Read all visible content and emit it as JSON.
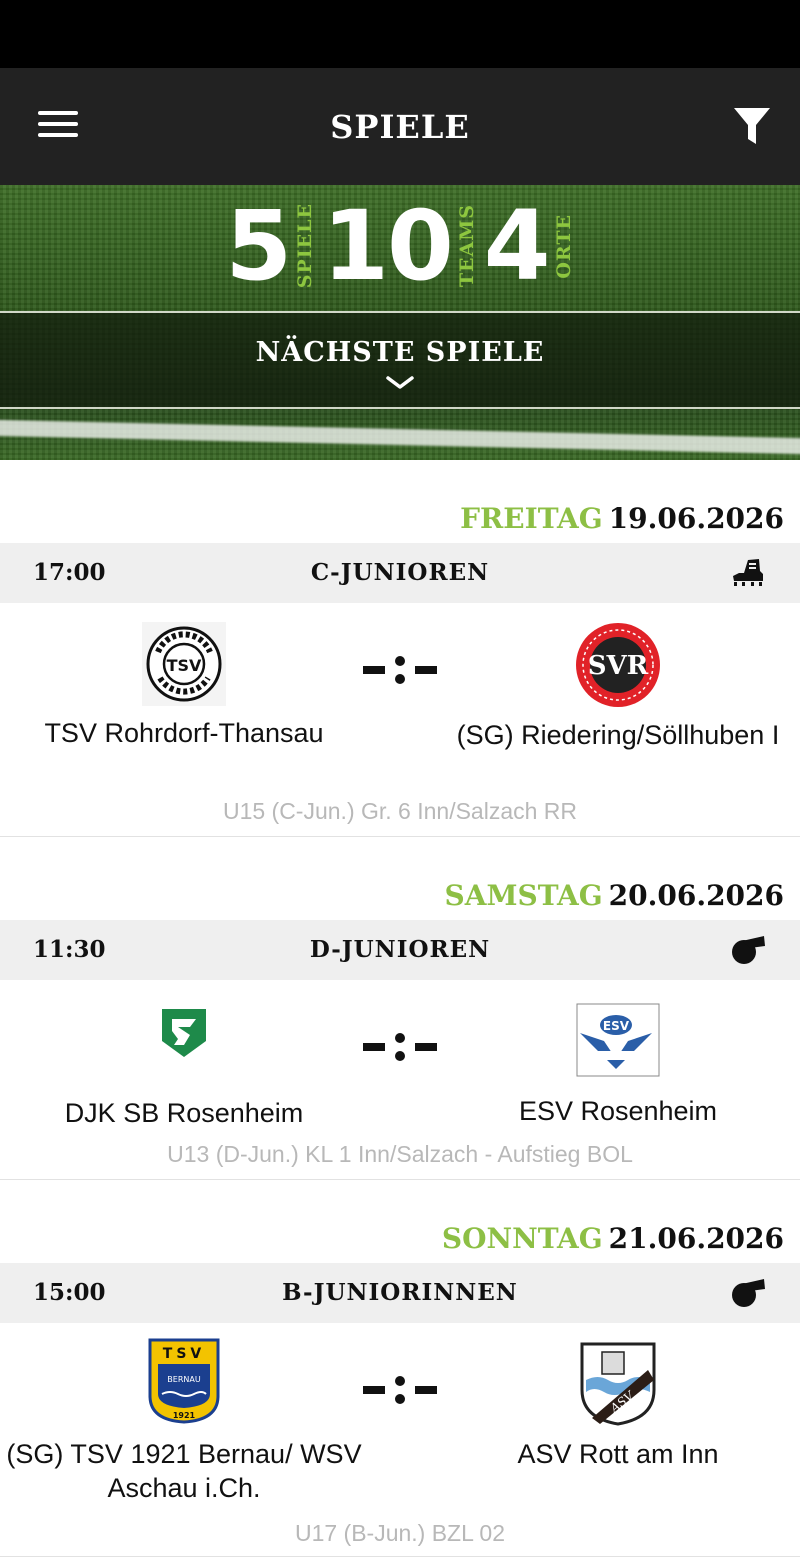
{
  "app": {
    "title": "SPIELE"
  },
  "header": {
    "menu_icon": "hamburger-menu-icon",
    "filter_icon": "filter-funnel-icon"
  },
  "stats": [
    {
      "value": "5",
      "label": "SPIELE"
    },
    {
      "value": "10",
      "label": "TEAMS"
    },
    {
      "value": "4",
      "label": "ORTE"
    }
  ],
  "next_games": {
    "label": "NÄCHSTE SPIELE",
    "icon": "chevron-down-icon"
  },
  "colors": {
    "accent": "#8dbf45",
    "appbar": "#222222",
    "header_row": "#efefef",
    "league_text": "#b8b8b8"
  },
  "days": [
    {
      "weekday": "FREITAG",
      "date": "19.06.2026",
      "match": {
        "time": "17:00",
        "class": "C-JUNIOREN",
        "type_icon": "boot-cleat-icon",
        "home": "TSV Rohrdorf-Thansau",
        "away": "(SG) Riedering/Söllhuben I",
        "score": "-:-",
        "league": "U15 (C-Jun.) Gr. 6 Inn/Salzach RR"
      }
    },
    {
      "weekday": "SAMSTAG",
      "date": "20.06.2026",
      "match": {
        "time": "11:30",
        "class": "D-JUNIOREN",
        "type_icon": "whistle-icon",
        "home": "DJK SB Rosenheim",
        "away": "ESV Rosenheim",
        "score": "-:-",
        "league": "U13 (D-Jun.) KL 1  Inn/Salzach - Aufstieg BOL"
      }
    },
    {
      "weekday": "SONNTAG",
      "date": "21.06.2026",
      "match": {
        "time": "15:00",
        "class": "B-JUNIORINNEN",
        "type_icon": "whistle-icon",
        "home": "(SG) TSV 1921 Bernau/ WSV Aschau i.Ch.",
        "away": "ASV Rott am Inn",
        "score": "-:-",
        "league": "U17 (B-Jun.) BZL 02"
      }
    }
  ]
}
